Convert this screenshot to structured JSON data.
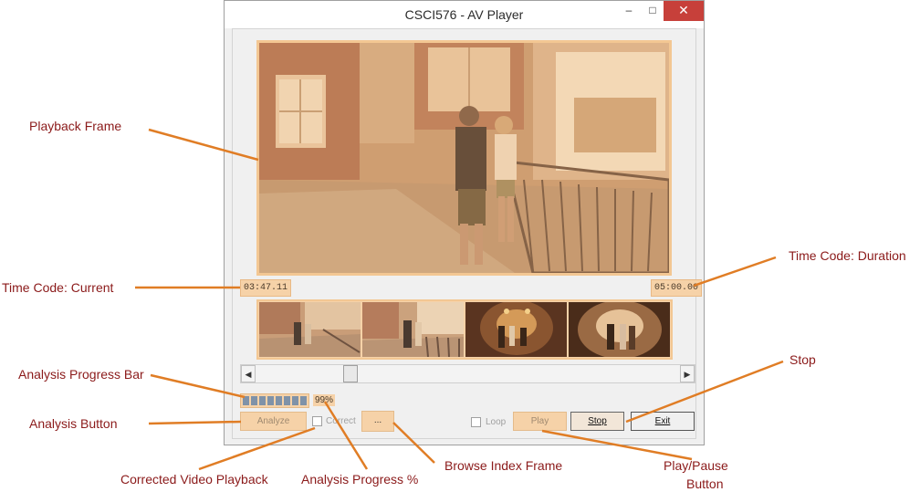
{
  "window": {
    "title": "CSCI576 - AV Player",
    "minimize_glyph": "–",
    "maximize_glyph": "□",
    "close_glyph": "✕"
  },
  "player": {
    "current_time": "03:47.11",
    "duration": "05:00.00",
    "progress_percent": 99,
    "progress_text": "99%",
    "analyze_label": "Analyze",
    "correct_label": "Correct",
    "browse_label": "...",
    "loop_label": "Loop",
    "play_label": "Play",
    "stop_label": "Stop",
    "exit_label": "Exit",
    "scroll_left_glyph": "◀",
    "scroll_right_glyph": "▶",
    "thumbnail_count": 4
  },
  "annotations": {
    "playback_frame": "Playback Frame",
    "time_current": "Time Code: Current",
    "time_duration": "Time Code: Duration",
    "progress_bar": "Analysis Progress Bar",
    "analysis_button": "Analysis Button",
    "corrected_playback": "Corrected Video Playback",
    "progress_pct": "Analysis Progress %",
    "browse_index": "Browse Index Frame",
    "stop": "Stop",
    "play_pause": "Play/Pause",
    "play_pause_line2": "Button"
  },
  "colors": {
    "annotation_text": "#8b1a1a",
    "annotation_line": "#e07d25",
    "frame_tint": "#f6d2a8",
    "close_button": "#c7403a"
  }
}
